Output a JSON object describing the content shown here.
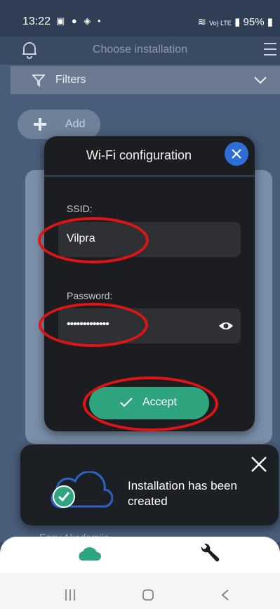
{
  "status_bar": {
    "time": "13:22",
    "notif_icons": "▣ ● ◈ •",
    "network": "Vo) LTE",
    "battery": "95%"
  },
  "header": {
    "title": "Choose installation"
  },
  "filters": {
    "label": "Filters"
  },
  "add": {
    "label": "Add"
  },
  "modal": {
    "title": "Wi-Fi configuration",
    "ssid_label": "SSID:",
    "ssid_value": "Vilpra",
    "password_label": "Password:",
    "password_value": "•••••••••••••",
    "accept_label": "Accept"
  },
  "toast": {
    "message": "Installation has been created"
  },
  "behind": {
    "text": "Ensy Akademija"
  },
  "colors": {
    "accent": "#2ea57f",
    "close": "#2d6fd6",
    "highlight": "#e01414"
  }
}
